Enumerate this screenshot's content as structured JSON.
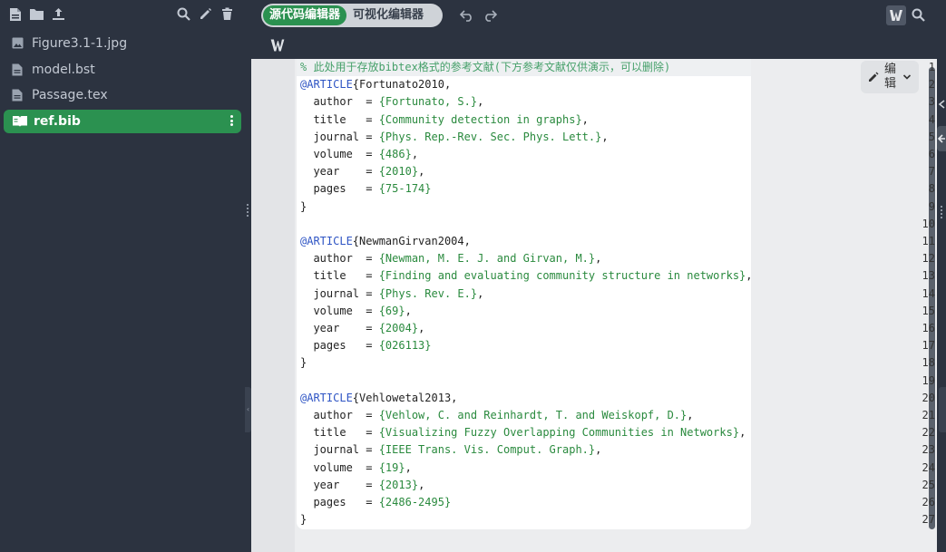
{
  "sidebar": {
    "toolbar_icons": [
      "new-file-icon",
      "new-folder-icon",
      "upload-icon",
      "search-icon",
      "rename-icon",
      "delete-icon"
    ],
    "files": [
      {
        "name": "Figure3.1-1.jpg",
        "icon": "image-file-icon"
      },
      {
        "name": "model.bst",
        "icon": "file-icon"
      },
      {
        "name": "Passage.tex",
        "icon": "file-icon"
      },
      {
        "name": "ref.bib",
        "icon": "book-icon",
        "active": true
      }
    ]
  },
  "editor": {
    "modes": [
      "源代码编辑器",
      "可视化编辑器"
    ],
    "active_mode": "源代码编辑器",
    "edit_button_label": "编辑",
    "lines": [
      {
        "n": "1",
        "parts": [
          {
            "t": "% 此处用于存放bibtex格式的参考文献(下方参考文献仅供演示，可以删除)",
            "c": "comment"
          }
        ]
      },
      {
        "n": "2",
        "parts": [
          {
            "t": "@ARTICLE",
            "c": "kw"
          },
          {
            "t": "{Fortunato2010,",
            "c": "plain"
          }
        ]
      },
      {
        "n": "3",
        "parts": [
          {
            "t": "  author  = ",
            "c": "plain"
          },
          {
            "t": "{Fortunato, S.}",
            "c": "str"
          },
          {
            "t": ",",
            "c": "plain"
          }
        ]
      },
      {
        "n": "4",
        "parts": [
          {
            "t": "  title   = ",
            "c": "plain"
          },
          {
            "t": "{Community detection in graphs}",
            "c": "str"
          },
          {
            "t": ",",
            "c": "plain"
          }
        ]
      },
      {
        "n": "5",
        "parts": [
          {
            "t": "  journal = ",
            "c": "plain"
          },
          {
            "t": "{Phys. Rep.-Rev. Sec. Phys. Lett.}",
            "c": "str"
          },
          {
            "t": ",",
            "c": "plain"
          }
        ]
      },
      {
        "n": "6",
        "parts": [
          {
            "t": "  volume  = ",
            "c": "plain"
          },
          {
            "t": "{486}",
            "c": "str"
          },
          {
            "t": ",",
            "c": "plain"
          }
        ]
      },
      {
        "n": "7",
        "parts": [
          {
            "t": "  year    = ",
            "c": "plain"
          },
          {
            "t": "{2010}",
            "c": "str"
          },
          {
            "t": ",",
            "c": "plain"
          }
        ]
      },
      {
        "n": "8",
        "parts": [
          {
            "t": "  pages   = ",
            "c": "plain"
          },
          {
            "t": "{75-174}",
            "c": "str"
          }
        ]
      },
      {
        "n": "9",
        "parts": [
          {
            "t": "}",
            "c": "plain"
          }
        ]
      },
      {
        "n": "10",
        "parts": [
          {
            "t": "",
            "c": "plain"
          }
        ]
      },
      {
        "n": "11",
        "parts": [
          {
            "t": "@ARTICLE",
            "c": "kw"
          },
          {
            "t": "{NewmanGirvan2004,",
            "c": "plain"
          }
        ]
      },
      {
        "n": "12",
        "parts": [
          {
            "t": "  author  = ",
            "c": "plain"
          },
          {
            "t": "{Newman, M. E. J. and Girvan, M.}",
            "c": "str"
          },
          {
            "t": ",",
            "c": "plain"
          }
        ]
      },
      {
        "n": "13",
        "parts": [
          {
            "t": "  title   = ",
            "c": "plain"
          },
          {
            "t": "{Finding and evaluating community structure in networks}",
            "c": "str"
          },
          {
            "t": ",",
            "c": "plain"
          }
        ]
      },
      {
        "n": "14",
        "parts": [
          {
            "t": "  journal = ",
            "c": "plain"
          },
          {
            "t": "{Phys. Rev. E.}",
            "c": "str"
          },
          {
            "t": ",",
            "c": "plain"
          }
        ]
      },
      {
        "n": "15",
        "parts": [
          {
            "t": "  volume  = ",
            "c": "plain"
          },
          {
            "t": "{69}",
            "c": "str"
          },
          {
            "t": ",",
            "c": "plain"
          }
        ]
      },
      {
        "n": "16",
        "parts": [
          {
            "t": "  year    = ",
            "c": "plain"
          },
          {
            "t": "{2004}",
            "c": "str"
          },
          {
            "t": ",",
            "c": "plain"
          }
        ]
      },
      {
        "n": "17",
        "parts": [
          {
            "t": "  pages   = ",
            "c": "plain"
          },
          {
            "t": "{026113}",
            "c": "str"
          }
        ]
      },
      {
        "n": "18",
        "parts": [
          {
            "t": "}",
            "c": "plain"
          }
        ]
      },
      {
        "n": "19",
        "parts": [
          {
            "t": "",
            "c": "plain"
          }
        ]
      },
      {
        "n": "20",
        "parts": [
          {
            "t": "@ARTICLE",
            "c": "kw"
          },
          {
            "t": "{Vehlowetal2013,",
            "c": "plain"
          }
        ]
      },
      {
        "n": "21",
        "parts": [
          {
            "t": "  author  = ",
            "c": "plain"
          },
          {
            "t": "{Vehlow, C. and Reinhardt, T. and Weiskopf, D.}",
            "c": "str"
          },
          {
            "t": ",",
            "c": "plain"
          }
        ]
      },
      {
        "n": "22",
        "parts": [
          {
            "t": "  title   = ",
            "c": "plain"
          },
          {
            "t": "{Visualizing Fuzzy Overlapping Communities in Networks}",
            "c": "str"
          },
          {
            "t": ",",
            "c": "plain"
          }
        ]
      },
      {
        "n": "23",
        "parts": [
          {
            "t": "  journal = ",
            "c": "plain"
          },
          {
            "t": "{IEEE Trans. Vis. Comput. Graph.}",
            "c": "str"
          },
          {
            "t": ",",
            "c": "plain"
          }
        ]
      },
      {
        "n": "24",
        "parts": [
          {
            "t": "  volume  = ",
            "c": "plain"
          },
          {
            "t": "{19}",
            "c": "str"
          },
          {
            "t": ",",
            "c": "plain"
          }
        ]
      },
      {
        "n": "25",
        "parts": [
          {
            "t": "  year    = ",
            "c": "plain"
          },
          {
            "t": "{2013}",
            "c": "str"
          },
          {
            "t": ",",
            "c": "plain"
          }
        ]
      },
      {
        "n": "26",
        "parts": [
          {
            "t": "  pages   = ",
            "c": "plain"
          },
          {
            "t": "{2486-2495}",
            "c": "str"
          }
        ]
      },
      {
        "n": "27",
        "parts": [
          {
            "t": "}",
            "c": "plain"
          }
        ]
      }
    ]
  },
  "colors": {
    "accent": "#2b9150",
    "sidebar_bg": "#2c3340",
    "keyword": "#2f55c4",
    "string": "#2a8a3e",
    "comment": "#46a06a"
  }
}
